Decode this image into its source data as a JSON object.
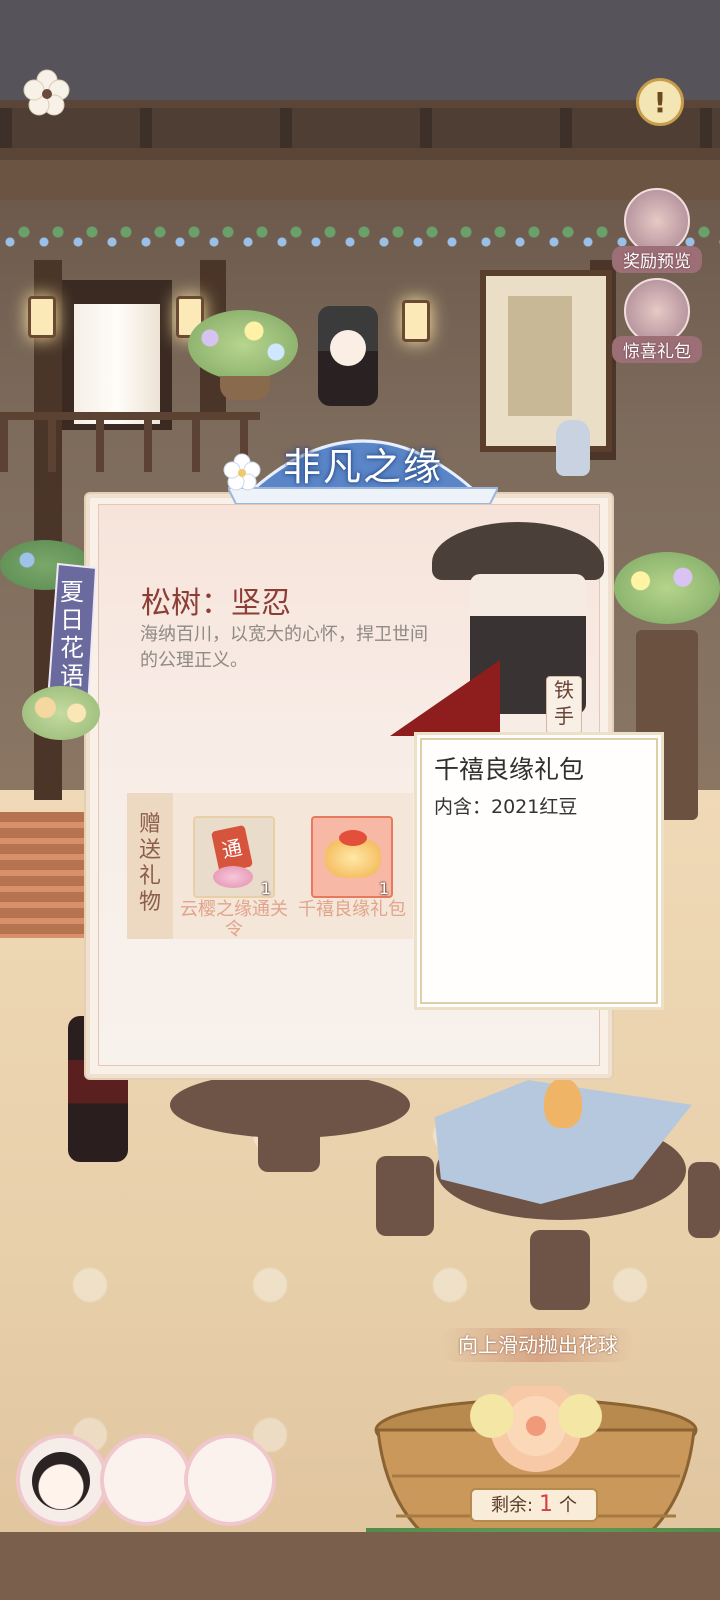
{
  "top": {
    "left_icon": "plum-blossom-icon",
    "right_icon": "exclamation-icon",
    "right_symbol": "!"
  },
  "side_buttons": [
    {
      "label": "奖励预览",
      "icon": "reward-box-icon"
    },
    {
      "label": "惊喜礼包",
      "icon": "gift-pouch-icon"
    }
  ],
  "panel": {
    "title": "非凡之缘",
    "side_tag": "夏日花语",
    "flower_title": "松树：坚忍",
    "flower_desc": "海纳百川，以宽大的心怀，捍卫世间的公理正义。",
    "npc_name": "铁手",
    "gift_section_label": "赠送礼物",
    "gifts": [
      {
        "name": "云樱之缘通关令",
        "count": "1",
        "badge": "通",
        "icon": "pass-token-icon"
      },
      {
        "name": "千禧良缘礼包",
        "count": "1",
        "icon": "gift-bundle-icon"
      }
    ]
  },
  "tooltip": {
    "title": "千禧良缘礼包",
    "content": "内含：2021红豆"
  },
  "bottom": {
    "swipe_hint": "向上滑动抛出花球",
    "remaining_label": "剩余:",
    "remaining_count": "1",
    "remaining_unit": "个"
  },
  "colors": {
    "panel_title_bg": "#5a86c8",
    "accent_red": "#8c3d35",
    "tooltip_border": "#dfcfa7"
  }
}
